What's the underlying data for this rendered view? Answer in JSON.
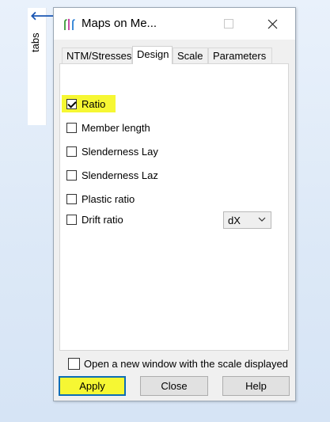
{
  "side_panel": {
    "label": "tabs",
    "arrow_icon": "back-arrow-icon",
    "arrow_color": "#1a56b3"
  },
  "window": {
    "title": "Maps on Me...",
    "minimize_icon": "minimize-icon",
    "maximize_icon": "maximize-icon",
    "close_icon": "close-icon"
  },
  "tabs": [
    {
      "label": "NTM/Stresses",
      "active": false
    },
    {
      "label": "Design",
      "active": true
    },
    {
      "label": "Scale",
      "active": false
    },
    {
      "label": "Parameters",
      "active": false
    }
  ],
  "options": [
    {
      "label": "Ratio",
      "checked": true,
      "highlighted": true
    },
    {
      "label": "Member length",
      "checked": false
    },
    {
      "label": "Slenderness Lay",
      "checked": false
    },
    {
      "label": "Slenderness Laz",
      "checked": false
    },
    {
      "label": "Plastic ratio",
      "checked": false
    },
    {
      "label": "Drift ratio",
      "checked": false
    }
  ],
  "drift_select": {
    "value": "dX"
  },
  "new_window_option": {
    "label": "Open a new window with the scale displayed",
    "checked": false
  },
  "buttons": {
    "apply": "Apply",
    "close": "Close",
    "help": "Help"
  },
  "colors": {
    "highlight": "#f6f733",
    "focus_border": "#0c6db5",
    "dialog_bg": "#f0f0f0"
  }
}
